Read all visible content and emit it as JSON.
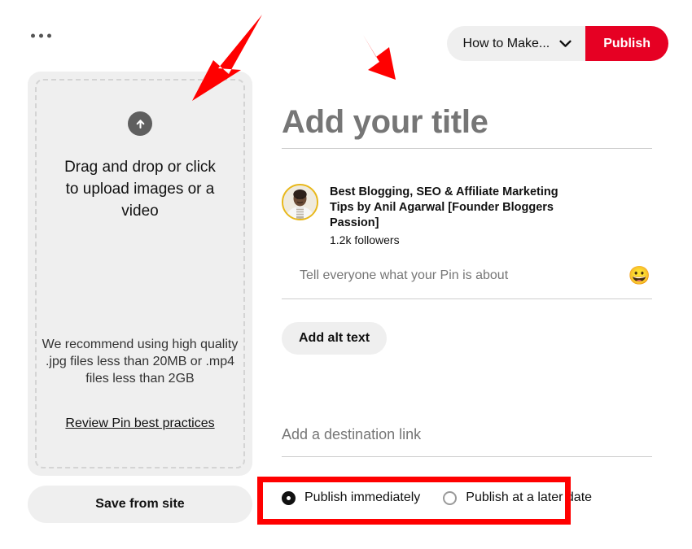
{
  "topbar": {
    "kebab_icon": "more-options-icon",
    "board_select_value": "How to Make...",
    "board_select_chevron": "chevron-down-icon",
    "publish_label": "Publish"
  },
  "uploader": {
    "upload_icon": "upload-arrow-icon",
    "dropzone_text": "Drag and drop or click to upload images or a video",
    "recommend_text": "We recommend using high quality .jpg files less than 20MB or .mp4 files less than 2GB",
    "best_practices_link": "Review Pin best practices",
    "save_from_site_label": "Save from site"
  },
  "details": {
    "title_placeholder": "Add your title",
    "author_name": "Best Blogging, SEO & Affiliate Marketing Tips by Anil Agarwal [Founder Bloggers Passion]",
    "follower_count": "1.2k followers",
    "avatar_icon": "user-avatar-photo",
    "description_placeholder": "Tell everyone what your Pin is about",
    "emoji_icon": "😀",
    "alt_text_label": "Add alt text",
    "destination_placeholder": "Add a destination link"
  },
  "schedule": {
    "options": [
      {
        "label": "Publish immediately",
        "selected": true
      },
      {
        "label": "Publish at a later date",
        "selected": false
      }
    ]
  },
  "annotations": {
    "arrow_color": "#ff0000",
    "highlight_color": "#ff0000",
    "arrow_1_target": "upload-dropzone",
    "arrow_2_target": "pin-title-field",
    "highlight_target": "schedule-radio-row"
  },
  "colors": {
    "brand_red": "#e60023",
    "annotation_red": "#ff0000",
    "panel_gray": "#efefef",
    "placeholder_gray": "#767676",
    "avatar_ring": "#e8b81c"
  }
}
